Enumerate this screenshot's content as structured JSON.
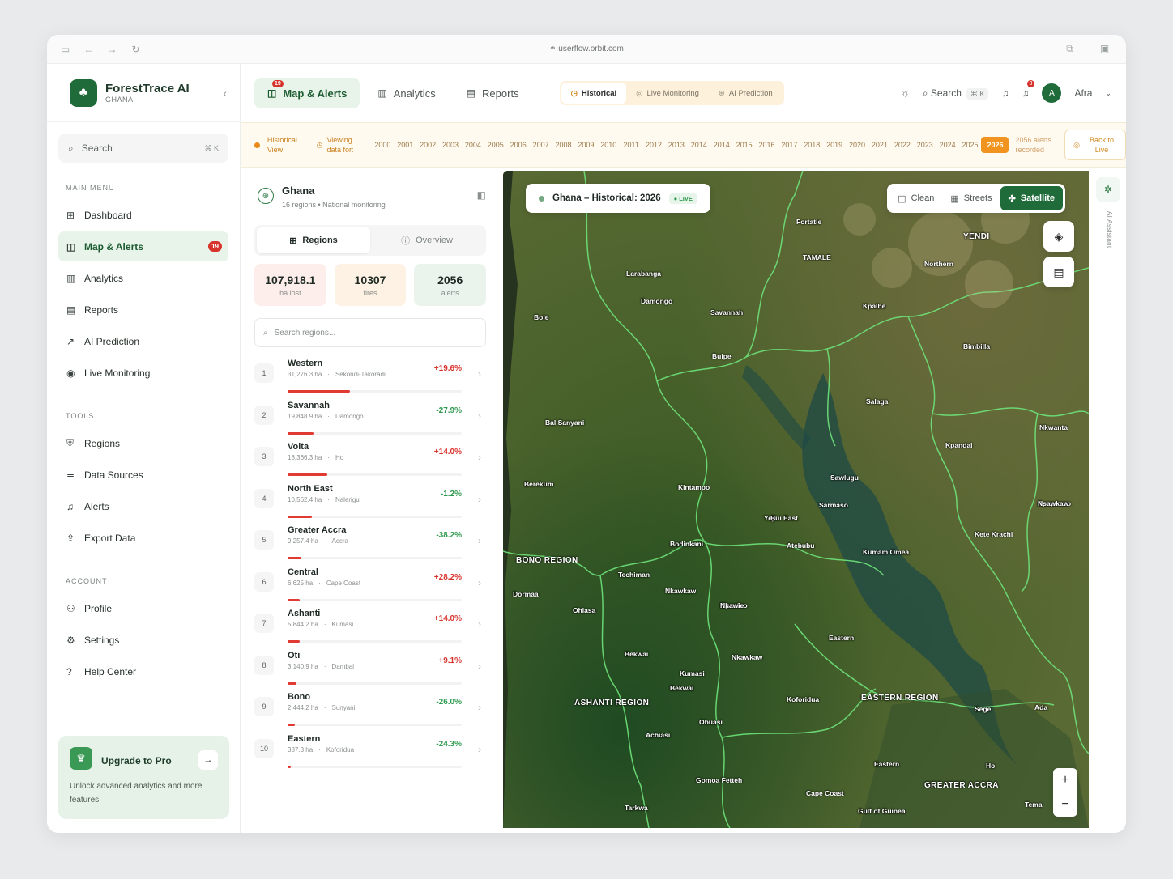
{
  "browser": {
    "url": "userflow.orbit.com"
  },
  "brand": {
    "name": "ForestTrace AI",
    "sub": "GHANA"
  },
  "sidebar": {
    "search_placeholder": "Search",
    "search_kbd": "⌘ K",
    "main_menu_title": "MAIN MENU",
    "main_menu": [
      {
        "label": "Dashboard",
        "icon": "dashboard-icon"
      },
      {
        "label": "Map & Alerts",
        "icon": "map-icon",
        "badge": "19",
        "active": true
      },
      {
        "label": "Analytics",
        "icon": "analytics-icon"
      },
      {
        "label": "Reports",
        "icon": "reports-icon"
      },
      {
        "label": "AI Prediction",
        "icon": "trend-icon"
      },
      {
        "label": "Live Monitoring",
        "icon": "monitoring-icon"
      }
    ],
    "tools_title": "TOOLS",
    "tools": [
      {
        "label": "Regions",
        "icon": "regions-icon"
      },
      {
        "label": "Data Sources",
        "icon": "database-icon"
      },
      {
        "label": "Alerts",
        "icon": "bell-icon"
      },
      {
        "label": "Export Data",
        "icon": "export-icon"
      }
    ],
    "account_title": "ACCOUNT",
    "account": [
      {
        "label": "Profile",
        "icon": "user-icon"
      },
      {
        "label": "Settings",
        "icon": "gear-icon"
      },
      {
        "label": "Help Center",
        "icon": "help-icon"
      }
    ],
    "upgrade": {
      "title": "Upgrade to Pro",
      "desc": "Unlock advanced analytics and more features."
    }
  },
  "topbar": {
    "tabs": [
      {
        "label": "Map & Alerts",
        "badge": "19",
        "active": true
      },
      {
        "label": "Analytics"
      },
      {
        "label": "Reports"
      }
    ],
    "modes": [
      {
        "label": "Historical",
        "active": true
      },
      {
        "label": "Live Monitoring"
      },
      {
        "label": "AI Prediction"
      }
    ],
    "search_label": "Search",
    "search_kbd": "⌘ K",
    "notifications_count": "3",
    "avatar_letter": "A",
    "user_name": "Afra"
  },
  "timeline": {
    "view_label": "Historical View",
    "viewing_label": "Viewing data for:",
    "years": [
      "2000",
      "2001",
      "2002",
      "2003",
      "2004",
      "2005",
      "2006",
      "2007",
      "2008",
      "2009",
      "2010",
      "2011",
      "2012",
      "2013",
      "2014",
      "2014",
      "2015",
      "2016",
      "2017",
      "2018",
      "2019",
      "2020",
      "2021",
      "2022",
      "2023",
      "2024",
      "2025",
      "2026"
    ],
    "selected_year": "2026",
    "alerts_recorded": "2056 alerts recorded",
    "back_to_live": "Back to Live"
  },
  "panel": {
    "title": "Ghana",
    "subtitle": "16 regions • National monitoring",
    "tab_regions": "Regions",
    "tab_overview": "Overview",
    "stats": [
      {
        "value": "107,918.1",
        "label": "ha lost"
      },
      {
        "value": "10307",
        "label": "fires"
      },
      {
        "value": "2056",
        "label": "alerts"
      }
    ],
    "search_placeholder": "Search regions...",
    "regions": [
      {
        "rank": "1",
        "name": "Western",
        "area": "31,276.3 ha",
        "city": "Sekondi-Takoradi",
        "change": "+19.6%",
        "share": 0.36
      },
      {
        "rank": "2",
        "name": "Savannah",
        "area": "19,848.9 ha",
        "city": "Damongo",
        "change": "-27.9%",
        "share": 0.15
      },
      {
        "rank": "3",
        "name": "Volta",
        "area": "18,366.3 ha",
        "city": "Ho",
        "change": "+14.0%",
        "share": 0.23
      },
      {
        "rank": "4",
        "name": "North East",
        "area": "10,562.4 ha",
        "city": "Nalerigu",
        "change": "-1.2%",
        "share": 0.14
      },
      {
        "rank": "5",
        "name": "Greater Accra",
        "area": "9,257.4 ha",
        "city": "Accra",
        "change": "-38.2%",
        "share": 0.08
      },
      {
        "rank": "6",
        "name": "Central",
        "area": "6,625 ha",
        "city": "Cape Coast",
        "change": "+28.2%",
        "share": 0.07
      },
      {
        "rank": "7",
        "name": "Ashanti",
        "area": "5,844.2 ha",
        "city": "Kumasi",
        "change": "+14.0%",
        "share": 0.07
      },
      {
        "rank": "8",
        "name": "Oti",
        "area": "3,140.9 ha",
        "city": "Dambai",
        "change": "+9.1%",
        "share": 0.05
      },
      {
        "rank": "9",
        "name": "Bono",
        "area": "2,444.2 ha",
        "city": "Sunyani",
        "change": "-26.0%",
        "share": 0.04
      },
      {
        "rank": "10",
        "name": "Eastern",
        "area": "387.3 ha",
        "city": "Koforidua",
        "change": "-24.3%",
        "share": 0.02
      }
    ]
  },
  "map": {
    "title": "Ghana – Historical: 2026",
    "live_badge": "● LIVE",
    "styles": [
      "Clean",
      "Streets",
      "Satellite"
    ],
    "active_style": "Satellite",
    "places": [
      {
        "name": "Fortatle"
      },
      {
        "name": "YENDI"
      },
      {
        "name": "TAMALE"
      },
      {
        "name": "Northern"
      },
      {
        "name": "Larabanga"
      },
      {
        "name": "Damongo"
      },
      {
        "name": "Savannah"
      },
      {
        "name": "Kpalbe"
      },
      {
        "name": "Bole"
      },
      {
        "name": "Bimbilla"
      },
      {
        "name": "Buipe"
      },
      {
        "name": "Salaga"
      },
      {
        "name": "Bal Sanyani"
      },
      {
        "name": "Kpandai"
      },
      {
        "name": "Nkwanta"
      },
      {
        "name": "Sawlugu"
      },
      {
        "name": "Berekum"
      },
      {
        "name": "Kintampo"
      },
      {
        "name": "Yeji"
      },
      {
        "name": "Sarmaso"
      },
      {
        "name": "Apaposso"
      },
      {
        "name": "Nsawkaw"
      },
      {
        "name": "Bui East"
      },
      {
        "name": "Kete Krachi"
      },
      {
        "name": "BONO REGION"
      },
      {
        "name": "Bodinkani"
      },
      {
        "name": "Atebubu"
      },
      {
        "name": "Kumam Omea"
      },
      {
        "name": "Techiman"
      },
      {
        "name": "Dormaa"
      },
      {
        "name": "Nkawkaw"
      },
      {
        "name": "Kpusiso"
      },
      {
        "name": "Ohiasa"
      },
      {
        "name": "Nkawie"
      },
      {
        "name": "Eastern"
      },
      {
        "name": "Bekwai"
      },
      {
        "name": "Nkawkaw"
      },
      {
        "name": "Kumasi"
      },
      {
        "name": "Bekwai"
      },
      {
        "name": "ASHANTI REGION"
      },
      {
        "name": "Koforidua"
      },
      {
        "name": "EASTERN REGION"
      },
      {
        "name": "Sege"
      },
      {
        "name": "Ada"
      },
      {
        "name": "Obuasi"
      },
      {
        "name": "Achiasi"
      },
      {
        "name": "Eastern"
      },
      {
        "name": "Ho"
      },
      {
        "name": "Gomoa Fetteh"
      },
      {
        "name": "GREATER ACCRA"
      },
      {
        "name": "Cape Coast"
      },
      {
        "name": "Tema"
      },
      {
        "name": "Tarkwa"
      },
      {
        "name": "Gulf of Guinea"
      }
    ]
  },
  "assistant": {
    "label": "AI Assistant"
  },
  "colors": {
    "brand": "#1f6b3a",
    "accent_orange": "#f0941f",
    "alert_red": "#d7332d",
    "success_green": "#2f9a4f"
  }
}
